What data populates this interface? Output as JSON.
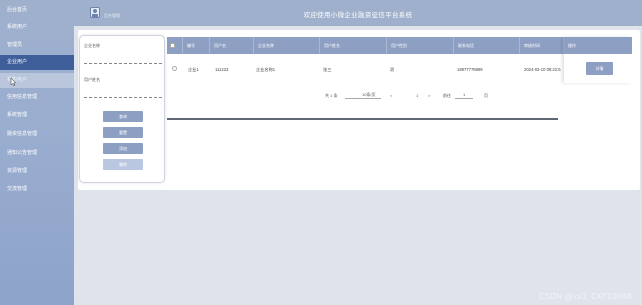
{
  "header": {
    "logo_text": "后台管理",
    "title": "欢迎使用小微企业融资征信平台系统"
  },
  "sidebar": {
    "items": [
      {
        "label": "后台首页"
      },
      {
        "label": "系统用户"
      },
      {
        "label": "管理员"
      },
      {
        "label": "企业用户"
      },
      {
        "label": "机构用户"
      },
      {
        "label": "信用信息管理"
      },
      {
        "label": "系统管理"
      },
      {
        "label": "融资信息管理"
      },
      {
        "label": "通知公告管理"
      },
      {
        "label": "资源管理"
      },
      {
        "label": "交流管理"
      }
    ]
  },
  "search": {
    "field1_label": "企业名称",
    "field2_label": "用户姓名",
    "buttons": [
      "查询",
      "重置",
      "添加",
      "删除"
    ]
  },
  "table": {
    "headers": [
      "",
      "编号",
      "用户名",
      "企业名称",
      "用户姓名",
      "用户性别",
      "联系电话",
      "审核时间"
    ],
    "op_header": "操作",
    "rows": [
      {
        "id": "企业1",
        "username": "111223",
        "company": "企业名称1",
        "name": "张三",
        "gender": "男",
        "phone": "18977778899",
        "time": "2024-03-10 09:22:5",
        "action": "详情"
      }
    ]
  },
  "pagination": {
    "total": "共 1 条",
    "page_size": "10条/页",
    "prev": "<",
    "page": "1",
    "next": ">",
    "goto": "前往",
    "goto_page": "1",
    "page_unit": "页"
  },
  "watermark": "CSDN @vx2_CKF10088"
}
